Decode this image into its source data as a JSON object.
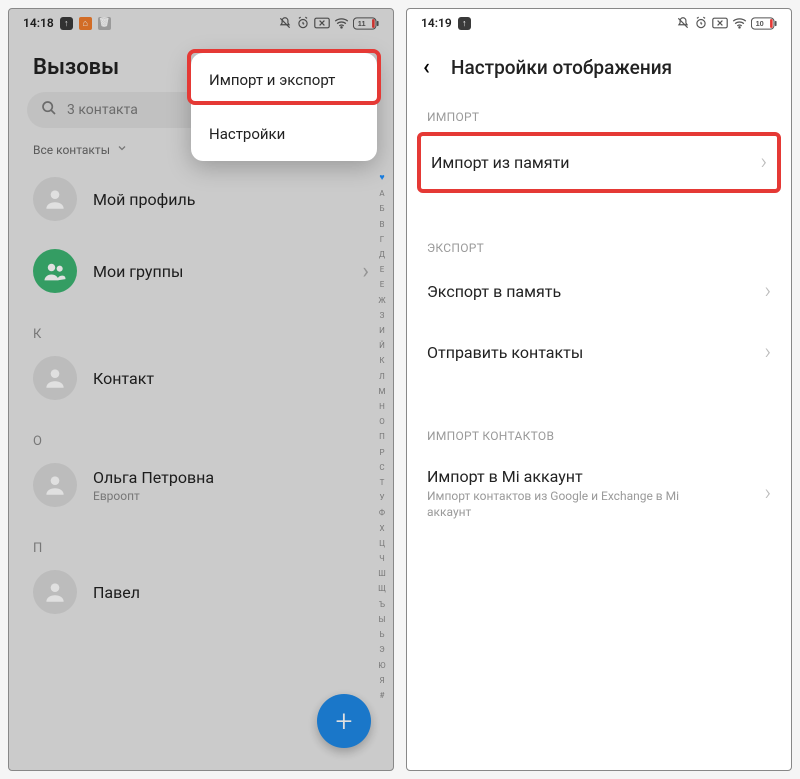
{
  "left": {
    "status": {
      "time": "14:18",
      "battery": "11"
    },
    "title": "Вызовы",
    "search_placeholder": "3 контакта",
    "filter_label": "Все контакты",
    "my_profile": "Мой профиль",
    "my_groups": "Мои группы",
    "sections": {
      "k": {
        "letter": "К",
        "contact": "Контакт"
      },
      "o": {
        "letter": "О",
        "contact": "Ольга Петровна",
        "sub": "Евроопт"
      },
      "p": {
        "letter": "П",
        "contact": "Павел"
      }
    },
    "index": [
      "А",
      "Б",
      "В",
      "Г",
      "Д",
      "Е",
      "Е",
      "Ж",
      "З",
      "И",
      "Й",
      "К",
      "Л",
      "М",
      "Н",
      "О",
      "П",
      "Р",
      "С",
      "Т",
      "У",
      "Ф",
      "Х",
      "Ц",
      "Ч",
      "Ш",
      "Щ",
      "Ъ",
      "Ы",
      "Ь",
      "Э",
      "Ю",
      "Я",
      "#"
    ],
    "dropdown": {
      "import_export": "Импорт и экспорт",
      "settings": "Настройки"
    }
  },
  "right": {
    "status": {
      "time": "14:19",
      "battery": "10"
    },
    "title": "Настройки отображения",
    "groups": {
      "import": {
        "header": "ИМПОРТ",
        "from_memory": "Импорт из памяти"
      },
      "export": {
        "header": "ЭКСПОРТ",
        "to_memory": "Экспорт в память",
        "share": "Отправить контакты"
      },
      "import_contacts": {
        "header": "ИМПОРТ КОНТАКТОВ",
        "to_mi": "Импорт в Mi аккаунт",
        "to_mi_sub": "Импорт контактов из Google и Exchange в Mi аккаунт"
      }
    }
  }
}
